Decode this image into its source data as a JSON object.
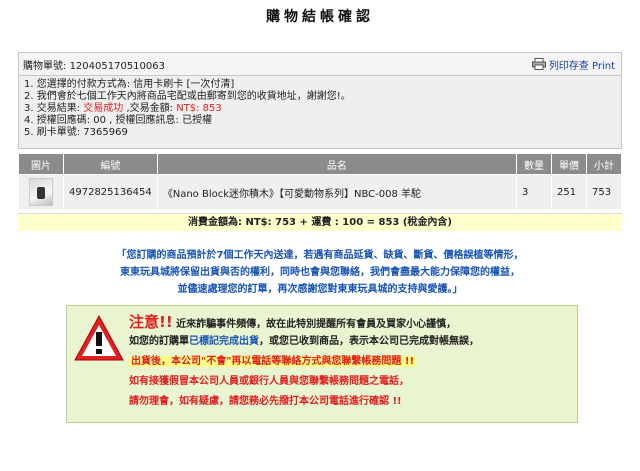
{
  "page": {
    "title": "購物結帳確認"
  },
  "order": {
    "label": "購物單號:",
    "number": "120405170510063",
    "print_label": "列印存查 Print",
    "lines": [
      {
        "prefix": "1. 您選擇的付款方式為: 信用卡刷卡 [一次付清]"
      },
      {
        "prefix": "2. 我們會於七個工作天內將商品宅配或由郵寄到您的收貨地址，謝謝您!。"
      },
      {
        "prefix": "3. 交易結果: ",
        "red1": "交易成功",
        "mid": " ,交易金額: ",
        "red2": "NT$: 853"
      },
      {
        "prefix": "4. 授權回應碼: 00 , 授權回應訊息: 已授權"
      },
      {
        "prefix": "5. 刷卡單號: 7365969"
      }
    ]
  },
  "table": {
    "headers": [
      "圖片",
      "編號",
      "品名",
      "數量",
      "單價",
      "小計"
    ],
    "rows": [
      {
        "code": "4972825136454",
        "name": "《Nano Block迷你積木》【可愛動物系列】NBC-008 羊駝",
        "qty": "3",
        "price": "251",
        "subtotal": "753"
      }
    ],
    "total_text": "消費金額為: NT$: 753 + 運費 : 100 = 853 (稅金內含)"
  },
  "notice": {
    "lines": [
      "「您訂購的商品預計於7個工作天內送達，若遇有商品延貨、缺貨、斷貨、價格誤植等情形，",
      "東東玩具城將保留出貨與否的權利，同時也會與您聯絡，我們會盡最大能力保障您的權益，",
      "並儘速處理您的訂單，再次感謝您對東東玩具城的支持與愛護。」"
    ]
  },
  "warning": {
    "head": "注意!!",
    "line1_rest": " 近來詐騙事件頻傳，故在此特別提醒所有會員及買家小心謹慎，",
    "line2_a": "如您的訂購單",
    "line2_b": "已標記完成出貨",
    "line2_c": "，或您已收到商品，表示本公司已完成對帳無誤，",
    "line3_a": "出貨後，本公司",
    "line3_b": "\"不會\"",
    "line3_c": "再以電話等聯絡方式與您聯繫帳務問題 !!",
    "line4": "如有接獲假冒本公司人員或銀行人員與您聯繫帳務問題之電話，",
    "line5": "請勿理會，如有疑慮，請您務必先撥打本公司電話進行確認 !!"
  }
}
